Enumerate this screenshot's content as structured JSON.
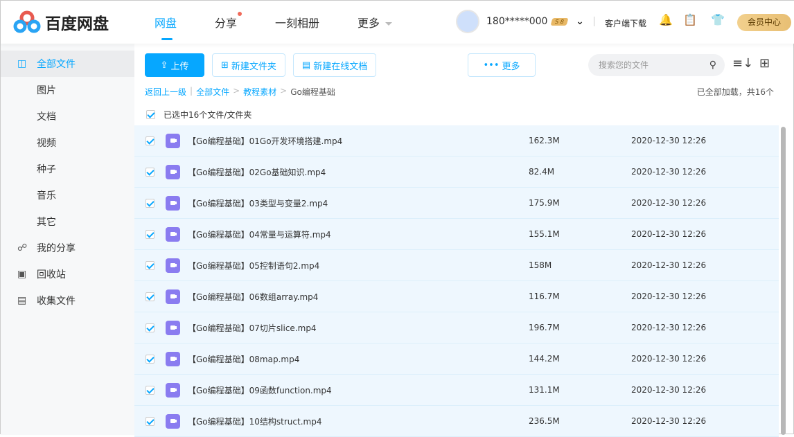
{
  "header": {
    "logo": "百度网盘",
    "nav": [
      {
        "label": "网盘",
        "active": true
      },
      {
        "label": "分享",
        "dot": true
      },
      {
        "label": "一刻相册"
      },
      {
        "label": "更多"
      }
    ],
    "username": "180*****000",
    "badge": "S 8",
    "download": "客户端下载",
    "vip": "会员中心"
  },
  "sidebar": {
    "items": [
      {
        "label": "全部文件",
        "icon": "files-icon"
      },
      {
        "label": "图片"
      },
      {
        "label": "文档"
      },
      {
        "label": "视频"
      },
      {
        "label": "种子"
      },
      {
        "label": "音乐"
      },
      {
        "label": "其它"
      },
      {
        "label": "我的分享",
        "icon": "share-icon"
      },
      {
        "label": "回收站",
        "icon": "trash-icon"
      },
      {
        "label": "收集文件",
        "icon": "collect-icon"
      }
    ]
  },
  "toolbar": {
    "upload": "上传",
    "new_folder": "新建文件夹",
    "new_doc": "新建在线文档",
    "more": "更多",
    "search_placeholder": "搜索您的文件"
  },
  "breadcrumb": {
    "back": "返回上一级",
    "items": [
      "全部文件",
      "教程素材"
    ],
    "current": "Go编程基础"
  },
  "status": "已全部加载，共16个",
  "selection": "已选中16个文件/文件夹",
  "files": [
    {
      "name": "【Go编程基础】01Go开发环境搭建.mp4",
      "size": "162.3M",
      "date": "2020-12-30 12:26"
    },
    {
      "name": "【Go编程基础】02Go基础知识.mp4",
      "size": "82.4M",
      "date": "2020-12-30 12:26"
    },
    {
      "name": "【Go编程基础】03类型与变量2.mp4",
      "size": "175.9M",
      "date": "2020-12-30 12:26"
    },
    {
      "name": "【Go编程基础】04常量与运算符.mp4",
      "size": "155.1M",
      "date": "2020-12-30 12:26"
    },
    {
      "name": "【Go编程基础】05控制语句2.mp4",
      "size": "158M",
      "date": "2020-12-30 12:26"
    },
    {
      "name": "【Go编程基础】06数组array.mp4",
      "size": "116.7M",
      "date": "2020-12-30 12:26"
    },
    {
      "name": "【Go编程基础】07切片slice.mp4",
      "size": "196.7M",
      "date": "2020-12-30 12:26"
    },
    {
      "name": "【Go编程基础】08map.mp4",
      "size": "144.2M",
      "date": "2020-12-30 12:26"
    },
    {
      "name": "【Go编程基础】09函数function.mp4",
      "size": "131.1M",
      "date": "2020-12-30 12:26"
    },
    {
      "name": "【Go编程基础】10结构struct.mp4",
      "size": "236.5M",
      "date": "2020-12-30 12:26"
    }
  ]
}
